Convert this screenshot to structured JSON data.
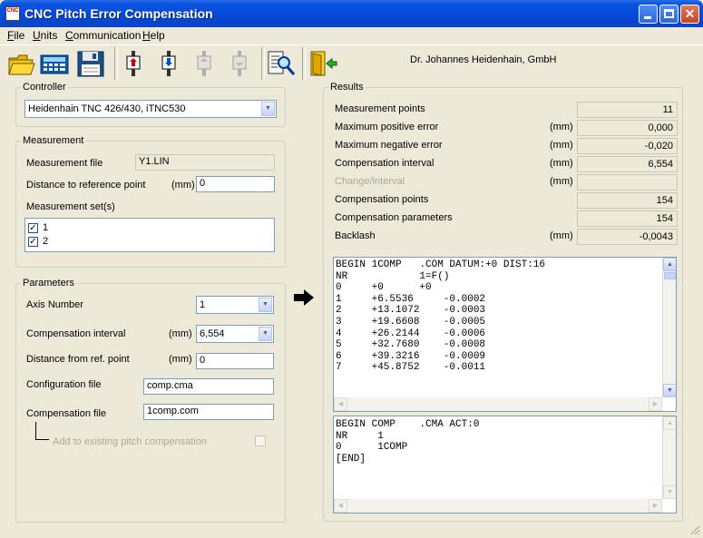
{
  "window": {
    "title": "CNC Pitch Error Compensation"
  },
  "menu": [
    {
      "label": "File",
      "u": "F",
      "rest": "ile"
    },
    {
      "label": "Units",
      "u": "U",
      "rest": "nits"
    },
    {
      "label": "Communication",
      "u": "C",
      "rest": "ommunication"
    },
    {
      "label": "Help",
      "u": "H",
      "rest": "elp"
    }
  ],
  "toolbar": {
    "icons": [
      "open-folder-icon",
      "calculator-icon",
      "save-disk-icon",
      "connector-send-icon",
      "connector-receive-icon",
      "connector-disabled-icon",
      "connector-disabled-2-icon",
      "search-magnify-icon",
      "exit-door-icon"
    ],
    "company": "Dr. Johannes Heidenhain, GmbH"
  },
  "controller": {
    "group": "Controller",
    "value": "Heidenhain TNC 426/430, iTNC530"
  },
  "measurement": {
    "group": "Measurement",
    "file_label": "Measurement file",
    "file_value": "Y1.LIN",
    "distance_label": "Distance to reference point",
    "distance_unit": "(mm)",
    "distance_value": "0",
    "sets_label": "Measurement set(s)",
    "sets": [
      "1",
      "2"
    ]
  },
  "parameters": {
    "group": "Parameters",
    "axis_label": "Axis Number",
    "axis_value": "1",
    "interval_label": "Compensation interval",
    "interval_unit": "(mm)",
    "interval_value": "6,554",
    "distance_label": "Distance from ref. point",
    "distance_unit": "(mm)",
    "distance_value": "0",
    "config_label": "Configuration file",
    "config_value": "comp.cma",
    "comp_label": "Compensation file",
    "comp_value": "1comp.com",
    "add_label": "Add to existing pitch compensation"
  },
  "results": {
    "group": "Results",
    "rows": [
      {
        "label": "Measurement points",
        "unit": "",
        "value": "11",
        "disabled": false
      },
      {
        "label": "Maximum positive error",
        "unit": "(mm)",
        "value": "0,000",
        "disabled": false
      },
      {
        "label": "Maximum negative error",
        "unit": "(mm)",
        "value": "-0,020",
        "disabled": false
      },
      {
        "label": "Compensation interval",
        "unit": "(mm)",
        "value": "6,554",
        "disabled": false
      },
      {
        "label": "Change/interval",
        "unit": "(mm)",
        "value": "",
        "disabled": true
      },
      {
        "label": "Compensation points",
        "unit": "",
        "value": "154",
        "disabled": false
      },
      {
        "label": "Compensation parameters",
        "unit": "",
        "value": "154",
        "disabled": false
      },
      {
        "label": "Backlash",
        "unit": "(mm)",
        "value": "-0,0043",
        "disabled": false
      }
    ],
    "com_lines": [
      "BEGIN 1COMP   .COM DATUM:+0 DIST:16",
      "NR            1=F()",
      "0     +0      +0",
      "1     +6.5536     -0.0002",
      "2     +13.1072    -0.0003",
      "3     +19.6608    -0.0005",
      "4     +26.2144    -0.0006",
      "5     +32.7680    -0.0008",
      "6     +39.3216    -0.0009",
      "7     +45.8752    -0.0011"
    ],
    "cma_lines": [
      "BEGIN COMP    .CMA ACT:0",
      "NR     1",
      "0      1COMP",
      "[END]"
    ]
  }
}
